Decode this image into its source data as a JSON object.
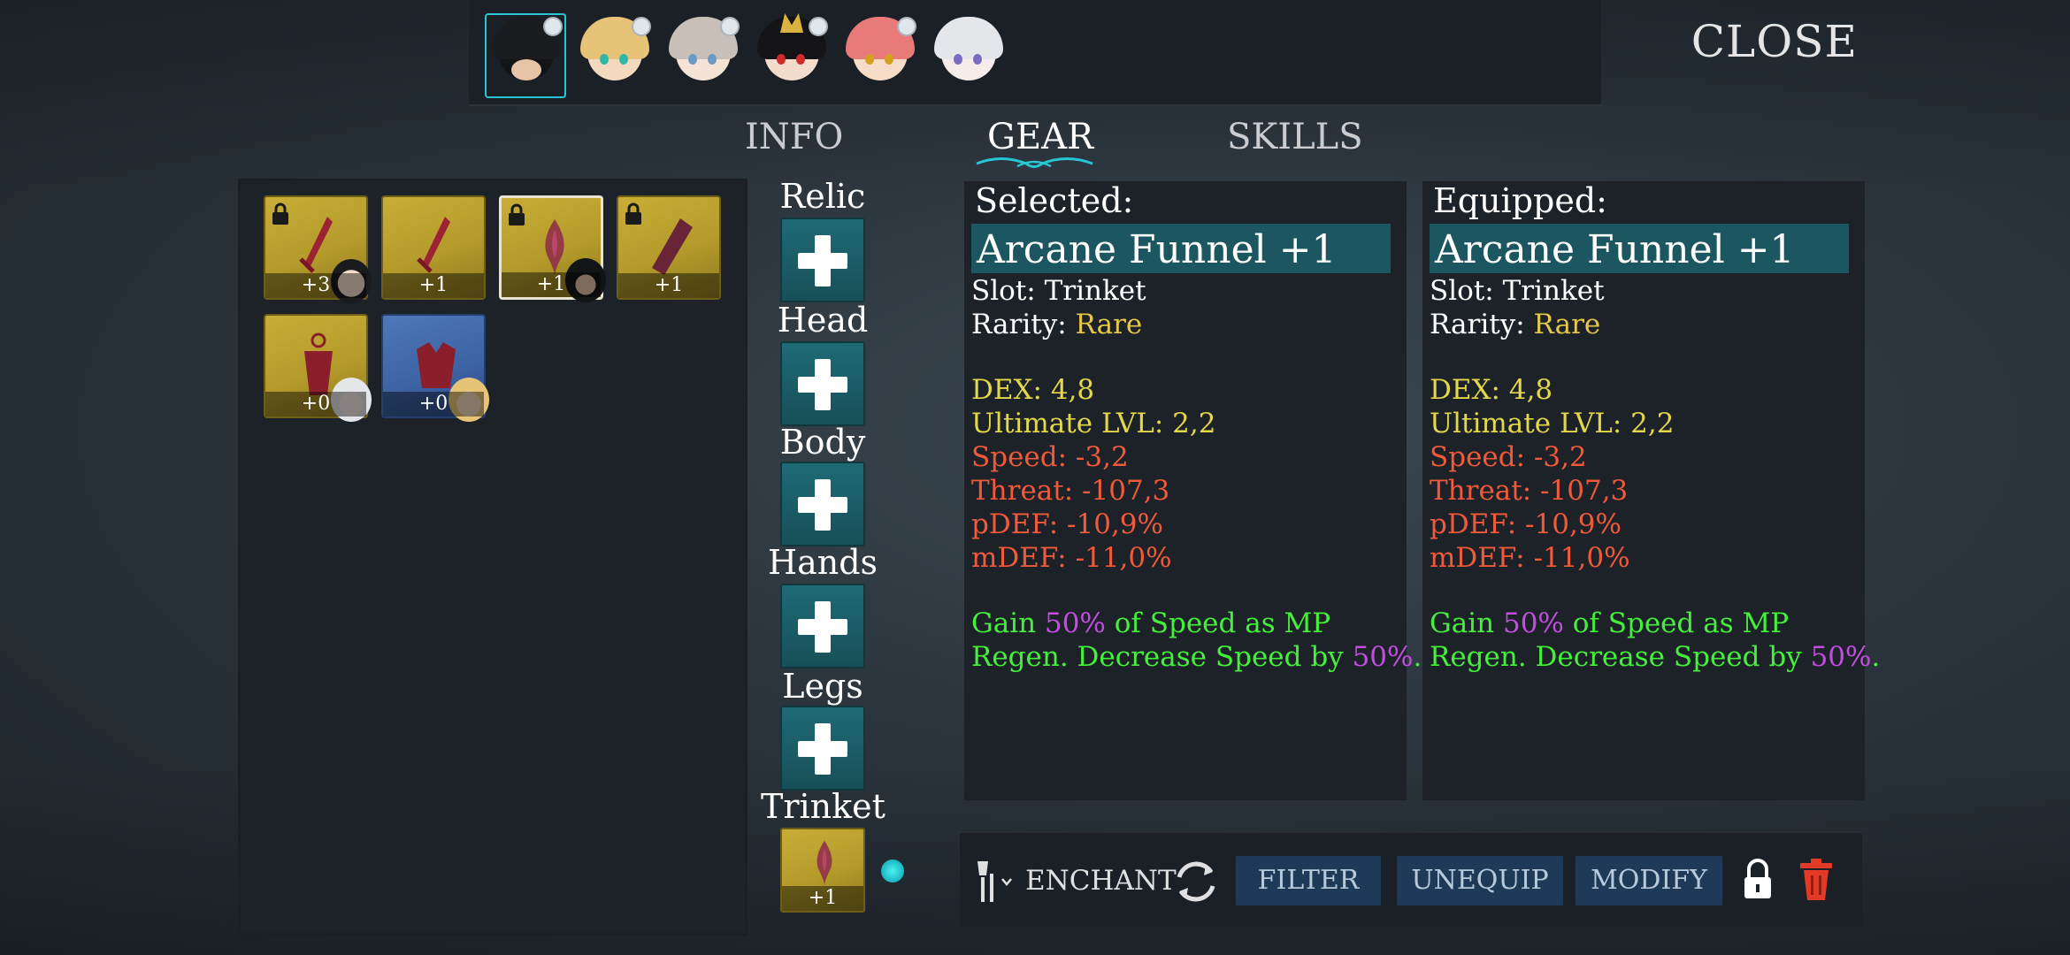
{
  "close_label": "CLOSE",
  "tabs": [
    {
      "label": "INFO",
      "active": false
    },
    {
      "label": "GEAR",
      "active": true
    },
    {
      "label": "SKILLS",
      "active": false
    }
  ],
  "party": [
    {
      "name": "hooded-character",
      "selected": true
    },
    {
      "name": "crowned-blonde-character",
      "selected": false
    },
    {
      "name": "maid-character",
      "selected": false
    },
    {
      "name": "horned-dark-character",
      "selected": false
    },
    {
      "name": "fox-pink-character",
      "selected": false
    },
    {
      "name": "white-hair-character",
      "selected": false
    }
  ],
  "inventory": [
    {
      "level": "+3",
      "locked": true,
      "color": "gold",
      "equipped_by": "dark-haired-character",
      "selected": false
    },
    {
      "level": "+1",
      "locked": false,
      "color": "gold",
      "equipped_by": "",
      "selected": false
    },
    {
      "level": "+1",
      "locked": true,
      "color": "gold",
      "equipped_by": "hooded-character",
      "selected": true
    },
    {
      "level": "+1",
      "locked": true,
      "color": "gold",
      "equipped_by": "",
      "selected": false
    },
    {
      "level": "+0",
      "locked": false,
      "color": "gold",
      "equipped_by": "white-hair-character",
      "selected": false
    },
    {
      "level": "+0",
      "locked": false,
      "color": "blue",
      "equipped_by": "crowned-blonde-character",
      "selected": false
    }
  ],
  "slots": [
    {
      "label": "Relic",
      "filled": false
    },
    {
      "label": "Head",
      "filled": false
    },
    {
      "label": "Body",
      "filled": false
    },
    {
      "label": "Hands",
      "filled": false
    },
    {
      "label": "Legs",
      "filled": false
    },
    {
      "label": "Trinket",
      "filled": true,
      "level": "+1"
    }
  ],
  "selected": {
    "heading": "Selected:",
    "name": "Arcane Funnel +1",
    "slot_label": "Slot: Trinket",
    "rarity_prefix": "Rarity: ",
    "rarity": "Rare",
    "stats": [
      {
        "text": "DEX: 4,8",
        "color": "yellow"
      },
      {
        "text": "Ultimate LVL: 2,2",
        "color": "yellow"
      },
      {
        "text": "Speed: -3,2",
        "color": "red"
      },
      {
        "text": "Threat: -107,3",
        "color": "red"
      },
      {
        "text": "pDEF: -10,9%",
        "color": "red"
      },
      {
        "text": "mDEF: -11,0%",
        "color": "red"
      }
    ],
    "passive": {
      "l1_a": "Gain ",
      "l1_b": "50%",
      "l1_c": " of Speed as MP",
      "l2_a": "Regen. Decrease Speed by ",
      "l2_b": "50%",
      "l2_c": "."
    }
  },
  "equipped": {
    "heading": "Equipped:",
    "name": "Arcane Funnel +1",
    "slot_label": "Slot: Trinket",
    "rarity_prefix": "Rarity: ",
    "rarity": "Rare",
    "stats": [
      {
        "text": "DEX: 4,8",
        "color": "yellow"
      },
      {
        "text": "Ultimate LVL: 2,2",
        "color": "yellow"
      },
      {
        "text": "Speed: -3,2",
        "color": "red"
      },
      {
        "text": "Threat: -107,3",
        "color": "red"
      },
      {
        "text": "pDEF: -10,9%",
        "color": "red"
      },
      {
        "text": "mDEF: -11,0%",
        "color": "red"
      }
    ],
    "passive": {
      "l1_a": "Gain ",
      "l1_b": "50%",
      "l1_c": " of Speed as MP",
      "l2_a": "Regen. Decrease Speed by ",
      "l2_b": "50%",
      "l2_c": "."
    }
  },
  "actions": {
    "enchant": "ENCHANT",
    "filter": "FILTER",
    "unequip": "UNEQUIP",
    "modify": "MODIFY"
  },
  "colors": {
    "accent_cyan": "#28c6d4",
    "rare": "#e5c74a",
    "positive_stat": "#e2d84a",
    "negative_stat": "#f05a3a",
    "passive": "#43f03a",
    "highlight": "#c24de0",
    "item_gold": "#c8ad36",
    "item_blue": "#4e78b9",
    "slot_teal": "#1e6b75",
    "button": "#1f3a58",
    "trash": "#e23a26"
  }
}
